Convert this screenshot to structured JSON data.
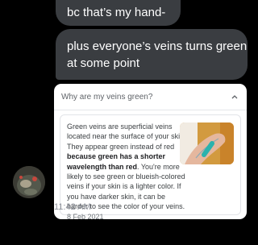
{
  "messages": [
    {
      "text": "bc that’s my hand-"
    },
    {
      "text": "plus everyone’s veins turns green at some point"
    }
  ],
  "search_card": {
    "question": "Why are my veins green?",
    "snippet": {
      "part1": "Green veins are superficial veins located near the surface of your skin. They appear green instead of red ",
      "bold": "because green has a shorter wavelength than red",
      "part2": ". You're more likely to see green or blueish-colored veins if your skin is a lighter color. If you have darker skin, it can be harder to see the color of your veins.",
      "date": "8 Feb 2021"
    }
  },
  "timestamp": "11:42 AM",
  "icons": {
    "collapse": "chevron-up-icon",
    "avatar": "user-avatar"
  },
  "colors": {
    "background": "#000000",
    "bubble": "#3a3d41",
    "card": "#ffffff",
    "timestamp": "#8e929b"
  }
}
